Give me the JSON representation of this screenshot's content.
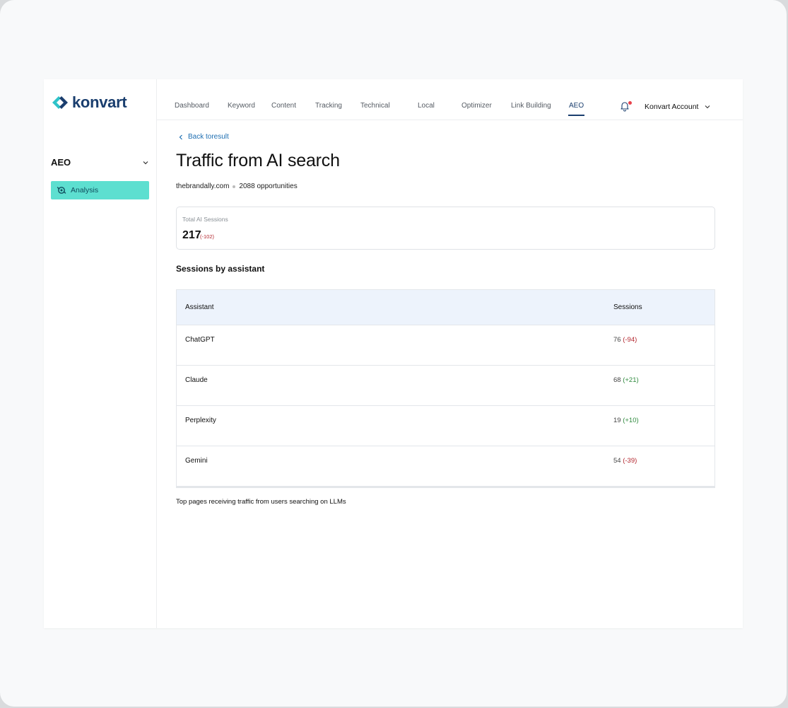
{
  "brand": {
    "name": "konvart"
  },
  "sidebar": {
    "section_title": "AEO",
    "items": [
      {
        "label": "Analysis"
      }
    ]
  },
  "topnav": {
    "tabs": [
      {
        "label": "Dashboard"
      },
      {
        "label": "Keyword"
      },
      {
        "label": "Content"
      },
      {
        "label": "Tracking"
      },
      {
        "label": "Technical"
      },
      {
        "label": "Local"
      },
      {
        "label": "Optimizer"
      },
      {
        "label": "Link Building"
      },
      {
        "label": "AEO"
      }
    ],
    "active_tab": "AEO",
    "account_label": "Konvart Account"
  },
  "page": {
    "back_link": "Back toresult",
    "title": "Traffic from AI search",
    "domain": "thebrandally.com",
    "opportunities": "2088 opportunities"
  },
  "stat": {
    "label": "Total AI Sessions",
    "value": "217",
    "delta": "(-102)"
  },
  "sessions_section": {
    "heading": "Sessions by assistant",
    "columns": [
      "Assistant",
      "Sessions"
    ],
    "rows": [
      {
        "assistant": "ChatGPT",
        "sessions": "76",
        "delta": "(-94)"
      },
      {
        "assistant": "Claude",
        "sessions": "68",
        "delta": "(+21)"
      },
      {
        "assistant": "Perplexity",
        "sessions": "19",
        "delta": "(+10)"
      },
      {
        "assistant": "Gemini",
        "sessions": "54",
        "delta": "(-39)"
      }
    ]
  },
  "footnote": "Top pages receiving traffic from users searching on LLMs",
  "colors": {
    "brand_navy": "#1a3e6e",
    "accent_teal": "#5ddfd0",
    "negative": "#b3262e",
    "positive": "#2f8a3e",
    "table_header_bg": "#edf3fc"
  }
}
